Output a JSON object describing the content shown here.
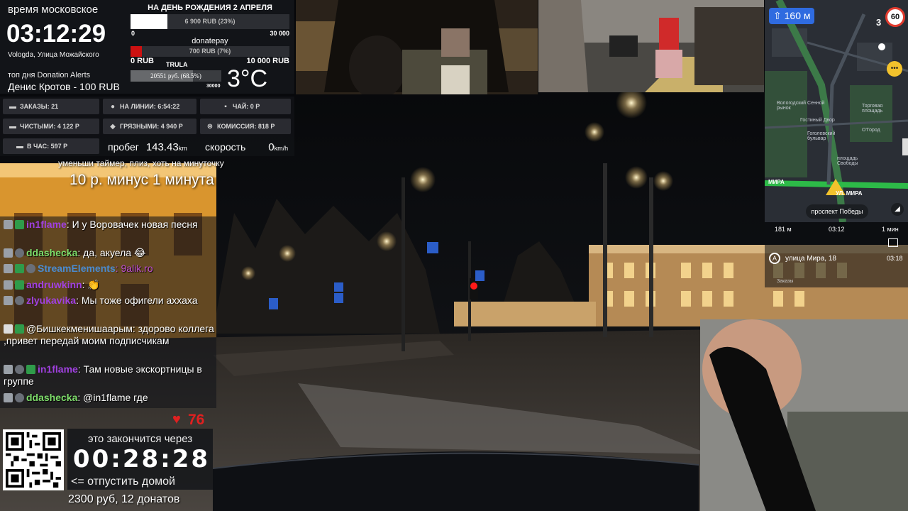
{
  "clock_panel": {
    "label": "время московское",
    "time": "03:12:29",
    "location": "Vologda, Улица Можайского",
    "top_day_label": "топ дня Donation Alerts",
    "top_day_value": "Денис Кротов - 100 RUB"
  },
  "goals": {
    "title": "НА ДЕНЬ РОЖДЕНИЯ 2 АПРЕЛЯ",
    "goal1": {
      "text": "6 900 RUB (23%)",
      "progress": 0.23,
      "min_label": "0",
      "max_label": "30 000",
      "fill_color": "#ffffff"
    },
    "goal2": {
      "name": "donatepay",
      "text": "700 RUB (7%)",
      "progress": 0.07,
      "min_label": "0 RUB",
      "max_label": "10 000 RUB",
      "fill_color": "#cc1111"
    },
    "goal3": {
      "name": "TRULA",
      "text": "20551 руб. (68.5%)",
      "progress": 0.685,
      "max_label": "30000",
      "fill_color": "#eeeeee"
    }
  },
  "temperature": "3°C",
  "stats": {
    "orders": "ЗАКАЗЫ: 21",
    "online": "НА ЛИНИИ: 6:54:22",
    "tea": "ЧАЙ: 0 Р",
    "net": "ЧИСТЫМИ: 4 122 Р",
    "gross": "ГРЯЗНЫМИ: 4 940 Р",
    "commission": "КОМИССИЯ: 818 Р",
    "per_hour": "В ЧАС: 597 Р"
  },
  "odometer": {
    "mileage_label": "пробег",
    "mileage_value": "143.43",
    "mileage_unit": "km",
    "speed_label": "скорость",
    "speed_value": "0",
    "speed_unit": "km/h"
  },
  "overlay": {
    "timer_hint": "уменьши таймер, плиз, хоть на минуточку",
    "timer_rule": "10 р. минус 1 минута"
  },
  "chat": [
    {
      "user": "in1flame",
      "hidden": true,
      "text": ": И у Воровачек новая песня"
    },
    {
      "user": "ddashecka",
      "color": "#7ddc6a",
      "text": ": да, акуела 😂"
    },
    {
      "user": "StreamElements",
      "hidden": true,
      "text": ": 9alik.ro"
    },
    {
      "user": "andruwkinn",
      "hidden": true,
      "text": ": 👏"
    },
    {
      "user": "zlyukavika",
      "hidden": true,
      "text": ": Мы тоже офигели аххаха"
    },
    {
      "user": "@Бишкекменишаарым",
      "color": "#ffffff",
      "text": ": здорово коллега ,привет передай моим подписчикам"
    },
    {
      "user": "in1flame",
      "hidden": true,
      "text": ": Там новые экскортницы в группе"
    },
    {
      "user": "ddashecka",
      "color": "#7ddc6a",
      "text": ": @in1flame где"
    }
  ],
  "hearts": "76",
  "timer": {
    "ends_label": "это закончится через",
    "countdown": "00:28:28",
    "release_label": "<=   отпустить домой",
    "donations_summary": "2300 руб, 12 донатов"
  },
  "navigator": {
    "distance": "160 м",
    "lanes": "3",
    "speed_limit": "60",
    "labels": [
      "Вологодский Сенной рынок",
      "Гостиный Двор",
      "Торговая площадь",
      "О'Город",
      "Гоголевский бульвар",
      "площадь Свободы"
    ],
    "street_main": "МИРА",
    "street_current": "УЛ. МИРА",
    "street_pill": "проспект Победы",
    "remaining_distance": "181 м",
    "current_time": "03:12",
    "remaining_time": "1 мин",
    "address": "улица Мира, 18",
    "arrival_time": "03:18",
    "orders_label": "Заказы"
  }
}
